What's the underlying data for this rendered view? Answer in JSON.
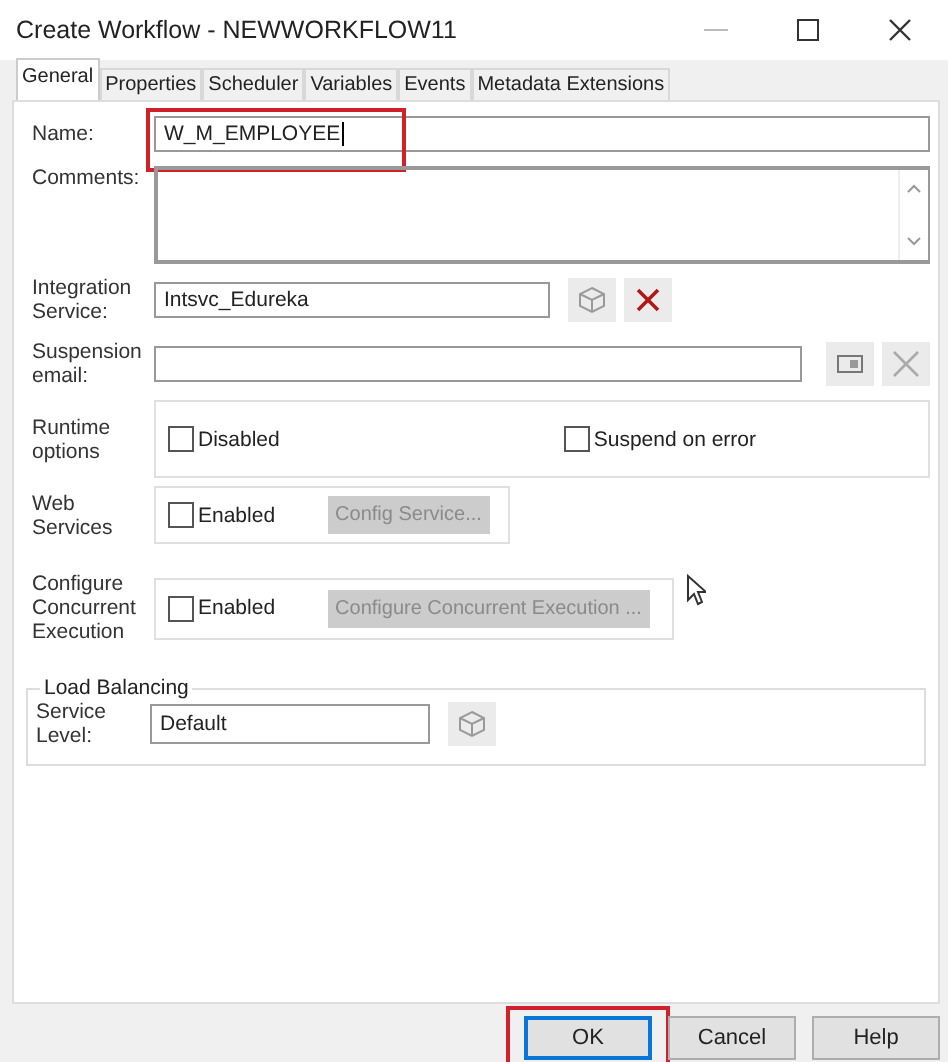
{
  "window": {
    "title": "Create Workflow - NEWWORKFLOW11"
  },
  "tabs": [
    {
      "label": "General",
      "selected": true
    },
    {
      "label": "Properties",
      "selected": false
    },
    {
      "label": "Scheduler",
      "selected": false
    },
    {
      "label": "Variables",
      "selected": false
    },
    {
      "label": "Events",
      "selected": false
    },
    {
      "label": "Metadata Extensions",
      "selected": false
    }
  ],
  "name": {
    "label": "Name:",
    "value": "W_M_EMPLOYEE",
    "highlighted": true
  },
  "comments": {
    "label": "Comments:"
  },
  "integration_service": {
    "label": "Integration Service:",
    "value": "Intsvc_Edureka",
    "clear_disabled": false
  },
  "suspension_email": {
    "label": "Suspension email:",
    "clear_disabled": true
  },
  "runtime_options": {
    "label": "Runtime options",
    "checkboxes": [
      {
        "label": "Disabled",
        "checked": false
      },
      {
        "label": "Suspend on error",
        "checked": false
      }
    ]
  },
  "web_services": {
    "label": "Web Services",
    "checkbox": {
      "label": "Enabled",
      "checked": false
    },
    "button": {
      "label": "Config Service...",
      "disabled": true
    }
  },
  "concurrent_execution": {
    "label": "Configure Concurrent Execution",
    "checkbox": {
      "label": "Enabled",
      "checked": false
    },
    "button": {
      "label": "Configure Concurrent Execution ...",
      "disabled": true
    }
  },
  "load_balancing": {
    "title": "Load Balancing",
    "label": "Service Level:",
    "value": "Default"
  },
  "buttons": [
    {
      "label": "OK",
      "default": true,
      "highlighted": true
    },
    {
      "label": "Cancel",
      "default": false,
      "highlighted": false
    },
    {
      "label": "Help",
      "default": false,
      "highlighted": false
    }
  ]
}
